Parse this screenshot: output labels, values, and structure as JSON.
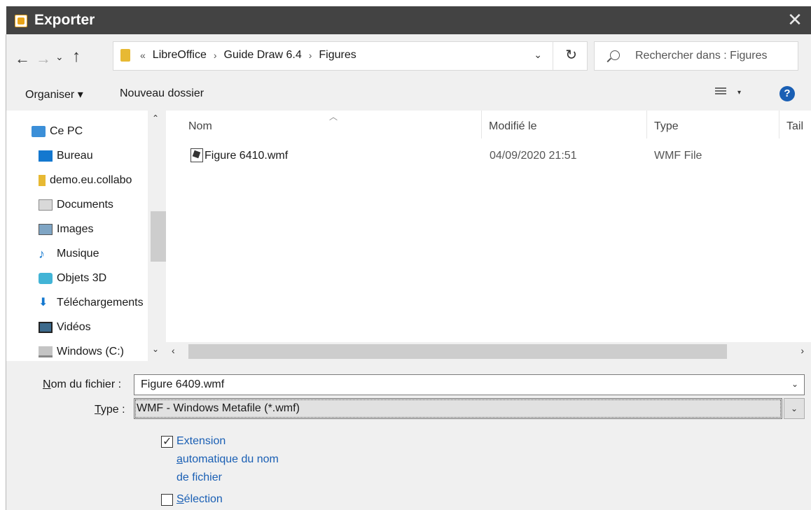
{
  "window": {
    "title": "Exporter",
    "close_symbol": "✕"
  },
  "nav": {
    "back": "←",
    "forward": "→",
    "recent": "⌄",
    "up": "↑"
  },
  "address": {
    "prefix": "«",
    "crumbs": [
      "LibreOffice",
      "Guide Draw 6.4",
      "Figures"
    ],
    "separator": "›",
    "dropdown": "⌄",
    "refresh": "↻"
  },
  "search": {
    "placeholder": "Rechercher dans : Figures"
  },
  "toolbar": {
    "organiser": "Organiser ▾",
    "new_folder": "Nouveau dossier",
    "view_caret": "▾",
    "help": "?"
  },
  "sidebar": {
    "items": [
      {
        "label": "Ce PC",
        "icon": "computer-icon"
      },
      {
        "label": "Bureau",
        "icon": "desktop-icon"
      },
      {
        "label": "demo.eu.collabo",
        "icon": "folder-icon"
      },
      {
        "label": "Documents",
        "icon": "documents-icon"
      },
      {
        "label": "Images",
        "icon": "images-icon"
      },
      {
        "label": "Musique",
        "icon": "music-icon"
      },
      {
        "label": "Objets 3D",
        "icon": "3d-objects-icon"
      },
      {
        "label": "Téléchargements",
        "icon": "downloads-icon"
      },
      {
        "label": "Vidéos",
        "icon": "videos-icon"
      },
      {
        "label": "Windows (C:)",
        "icon": "drive-icon"
      }
    ],
    "scroll_up": "⌃",
    "scroll_down": "⌄"
  },
  "files": {
    "columns": [
      "Nom",
      "Modifié le",
      "Type",
      "Tail"
    ],
    "sort_indicator": "︿",
    "rows": [
      {
        "name": "Figure 6410.wmf",
        "modified": "04/09/2020 21:51",
        "type": "WMF File"
      }
    ]
  },
  "hscroll": {
    "left": "‹",
    "right": "›"
  },
  "form": {
    "filename_label_underlined": "N",
    "filename_label_rest": "om du fichier :",
    "filename_value": "Figure 6409.wmf",
    "filename_caret": "⌄",
    "type_label_underlined": "T",
    "type_label_rest": "ype :",
    "type_value": "WMF - Windows Metafile (*.wmf)",
    "type_caret": "⌄",
    "ext_label_line1": "Extension",
    "ext_label_line2_underlined": "a",
    "ext_label_line2_rest": "utomatique du nom",
    "ext_label_line3": "de fichier",
    "ext_checked": true,
    "sel_label_underlined": "S",
    "sel_label_rest": "élection",
    "sel_checked": false
  }
}
